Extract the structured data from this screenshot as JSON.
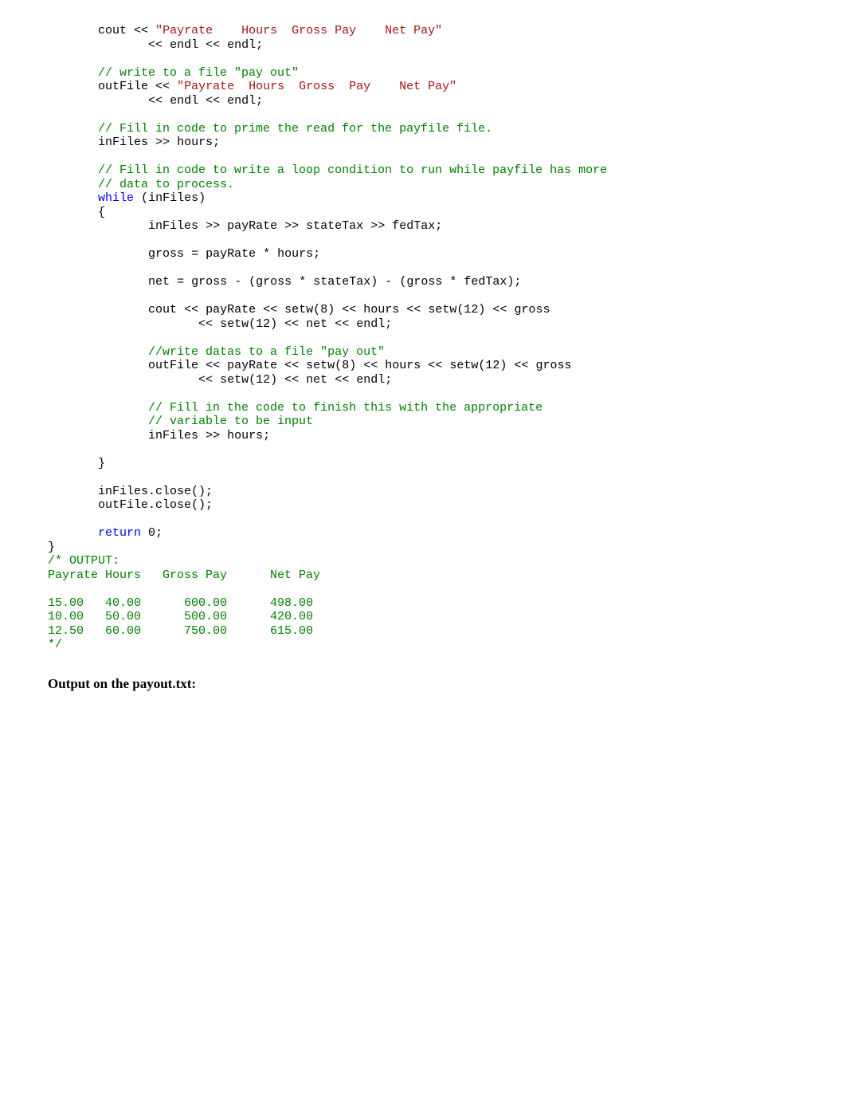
{
  "code": {
    "s1": "\"Payrate    Hours  Gross Pay    Net Pay\"",
    "c1": "// write to a file \"pay out\"",
    "s2": "\"Payrate  Hours  Gross  Pay    Net Pay\"",
    "c2": "// Fill in code to prime the read for the payfile file.",
    "c3": "// Fill in code to write a loop condition to run while payfile has more",
    "c4": "// data to process.",
    "kw_while": "while",
    "c5": "//write datas to a file \"pay out\"",
    "c6": "// Fill in the code to finish this with the appropriate",
    "c7": "// variable to be input",
    "kw_return": "return",
    "ret_val": "0",
    "out_header": "/* OUTPUT:",
    "out_line1": "Payrate Hours   Gross Pay      Net Pay",
    "out_line2": "15.00   40.00      600.00      498.00",
    "out_line3": "10.00   50.00      500.00      420.00",
    "out_line4": "12.50   60.00      750.00      615.00",
    "out_end": "*/",
    "id_cout": "cout",
    "id_outFile": "outFile",
    "id_inFiles": "inFiles",
    "id_hours": "hours",
    "id_payRate": "payRate",
    "id_stateTax": "stateTax",
    "id_fedTax": "fedTax",
    "id_gross": "gross",
    "id_net": "net",
    "id_setw": "setw",
    "id_endl": "endl",
    "br_open": "{",
    "br_close": "}",
    "semi": ";",
    "op_ins": "<<",
    "op_ext": ">>",
    "n8": "8",
    "n12": "12"
  },
  "prose": {
    "heading": "Output on the payout.txt:"
  }
}
